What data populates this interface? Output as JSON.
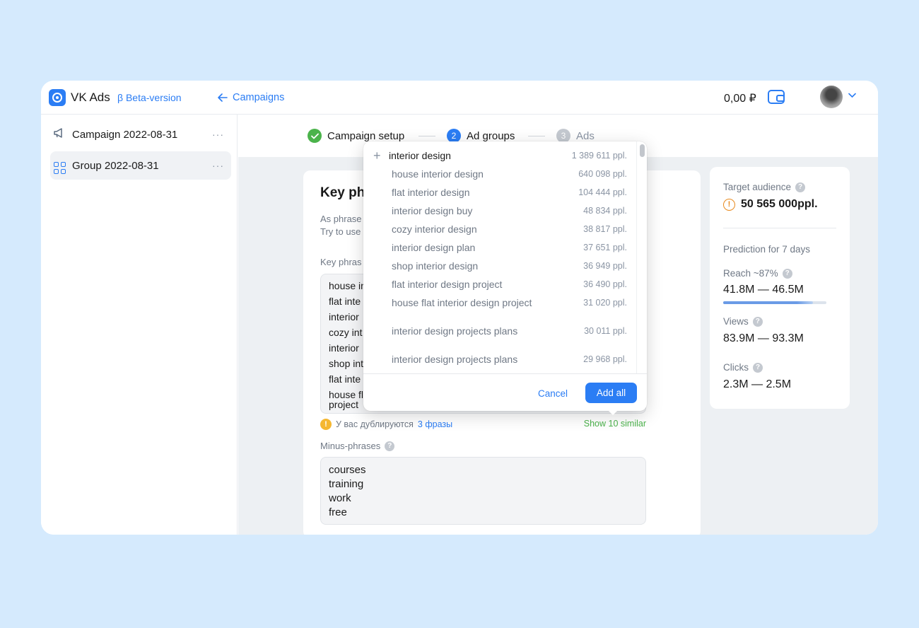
{
  "header": {
    "brand": "VK Ads",
    "beta": "β Beta-version",
    "back_link": "Campaigns",
    "balance": "0,00 ₽"
  },
  "sidebar": {
    "items": [
      {
        "label": "Campaign 2022-08-31",
        "icon": "megaphone-icon"
      },
      {
        "label": "Group 2022-08-31",
        "icon": "grid-icon"
      }
    ],
    "more": "···"
  },
  "steps": [
    {
      "label": "Campaign setup",
      "state": "done"
    },
    {
      "number": "2",
      "label": "Ad groups",
      "state": "active"
    },
    {
      "number": "3",
      "label": "Ads",
      "state": "pending"
    }
  ],
  "card": {
    "title": "Key ph",
    "hint_line1": "As phrase",
    "hint_line2": "Try to use",
    "key_label": "Key phras",
    "key_phrases": [
      "house in",
      "flat inte",
      "interior",
      "cozy int",
      "interior",
      "shop int",
      "flat inte",
      "house fl",
      "project"
    ],
    "duplicate_warning": "У вас дублируются",
    "duplicate_link": "3 фразы",
    "show_similar": "Show 10 similar",
    "minus_label": "Minus-phrases",
    "minus_phrases": [
      "courses",
      "training",
      "work",
      "free"
    ]
  },
  "stats": {
    "target_label": "Target audience",
    "target_value": "50 565 000ppl.",
    "prediction_label": "Prediction for 7 days",
    "reach_label": "Reach ~87%",
    "reach_value": "41.8M — 46.5M",
    "reach_fraction": 0.87,
    "views_label": "Views",
    "views_value": "83.9M — 93.3M",
    "clicks_label": "Clicks",
    "clicks_value": "2.3M — 2.5M"
  },
  "dropdown": {
    "items": [
      {
        "phrase": "interior design",
        "count": "1 389 611 ppl."
      },
      {
        "phrase": "house interior design",
        "count": "640 098 ppl."
      },
      {
        "phrase": "flat interior design",
        "count": "104 444 ppl."
      },
      {
        "phrase": "interior design buy",
        "count": "48 834 ppl."
      },
      {
        "phrase": "cozy interior design",
        "count": "38 817 ppl."
      },
      {
        "phrase": "interior design plan",
        "count": "37 651 ppl."
      },
      {
        "phrase": "shop interior design",
        "count": "36 949 ppl."
      },
      {
        "phrase": "flat interior design project",
        "count": "36 490 ppl."
      },
      {
        "phrase": "house flat interior design project",
        "count": "31 020 ppl."
      },
      {
        "phrase": "interior design projects plans",
        "count": "30 011 ppl."
      },
      {
        "phrase": "interior design projects plans",
        "count": "29 968 ppl."
      }
    ],
    "cancel_label": "Cancel",
    "add_all_label": "Add all"
  },
  "colors": {
    "accent": "#2b7df4",
    "success": "#4bb34b",
    "warning": "#f5b731",
    "background": "#d5eafd"
  }
}
